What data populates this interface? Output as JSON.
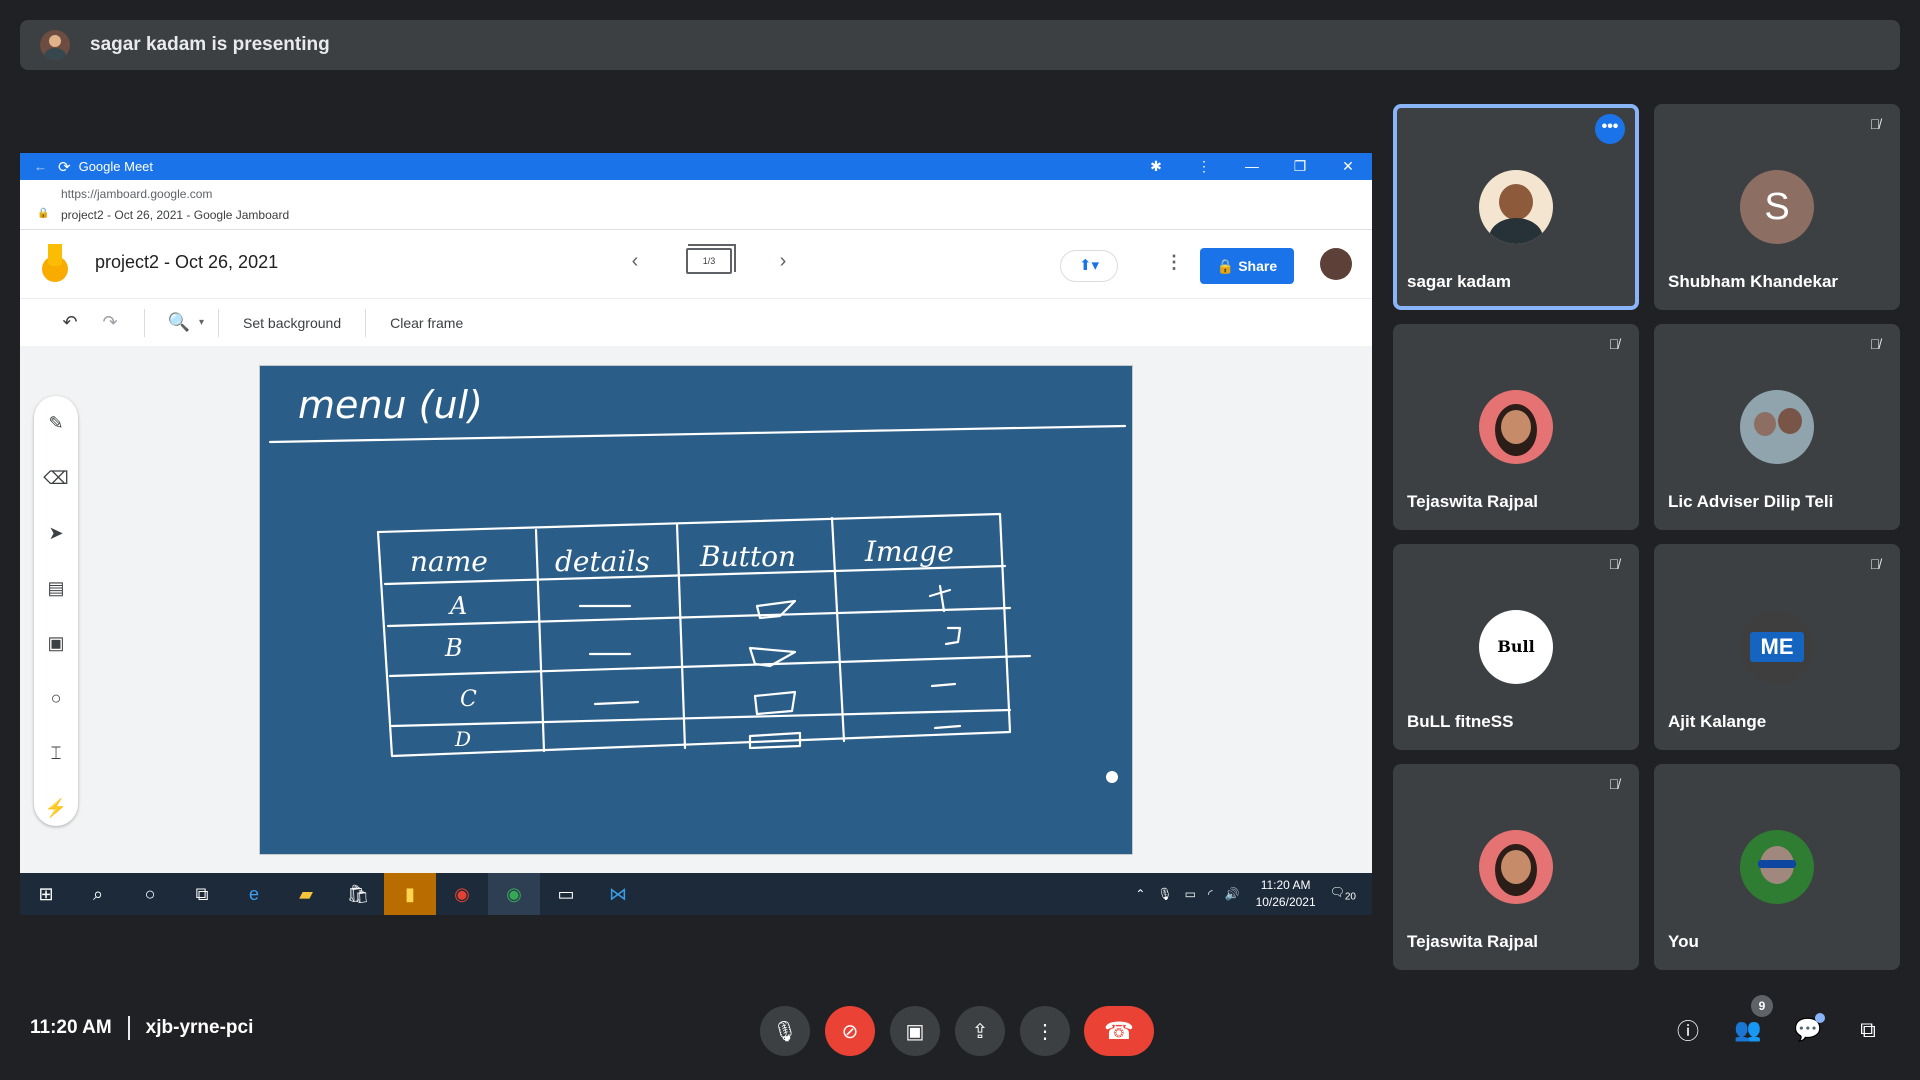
{
  "banner": {
    "text": "sagar kadam is presenting"
  },
  "shared": {
    "window_title": "Google Meet",
    "url": "https://jamboard.google.com",
    "page_title": "project2 - Oct 26, 2021 - Google Jamboard",
    "jam_title": "project2 - Oct 26, 2021",
    "frame_indicator": "1/3",
    "share_label": "Share",
    "toolbar": {
      "set_background": "Set background",
      "clear_frame": "Clear frame"
    },
    "board": {
      "heading": "menu (ul)",
      "table_headers": [
        "name",
        "details",
        "Button",
        "Image"
      ],
      "rows": [
        "A",
        "B",
        "C",
        "D"
      ]
    },
    "taskbar": {
      "time": "11:20 AM",
      "date": "10/26/2021",
      "notifications": "20"
    },
    "colors": {
      "board": "#2a5d87",
      "title_bar": "#1a73e8"
    }
  },
  "participants": [
    {
      "name": "sagar kadam",
      "muted": false,
      "active": true
    },
    {
      "name": "Shubham Khandekar",
      "muted": true,
      "initial": "S"
    },
    {
      "name": "Tejaswita Rajpal",
      "muted": true
    },
    {
      "name": "Lic Adviser Dilip Teli",
      "muted": true
    },
    {
      "name": "BuLL fitneSS",
      "muted": true,
      "logo_text": "Bull"
    },
    {
      "name": "Ajit Kalange",
      "muted": true,
      "logo_text": "ME"
    },
    {
      "name": "Tejaswita Rajpal",
      "muted": true
    },
    {
      "name": "You",
      "muted": false
    }
  ],
  "meeting": {
    "time": "11:20 AM",
    "code": "xjb-yrne-pci",
    "participant_count": "9"
  },
  "icons": [
    "mic-icon",
    "camera-off-icon",
    "captions-icon",
    "present-icon",
    "more-icon",
    "end-call-icon",
    "info-icon",
    "people-icon",
    "chat-icon",
    "activities-icon"
  ]
}
